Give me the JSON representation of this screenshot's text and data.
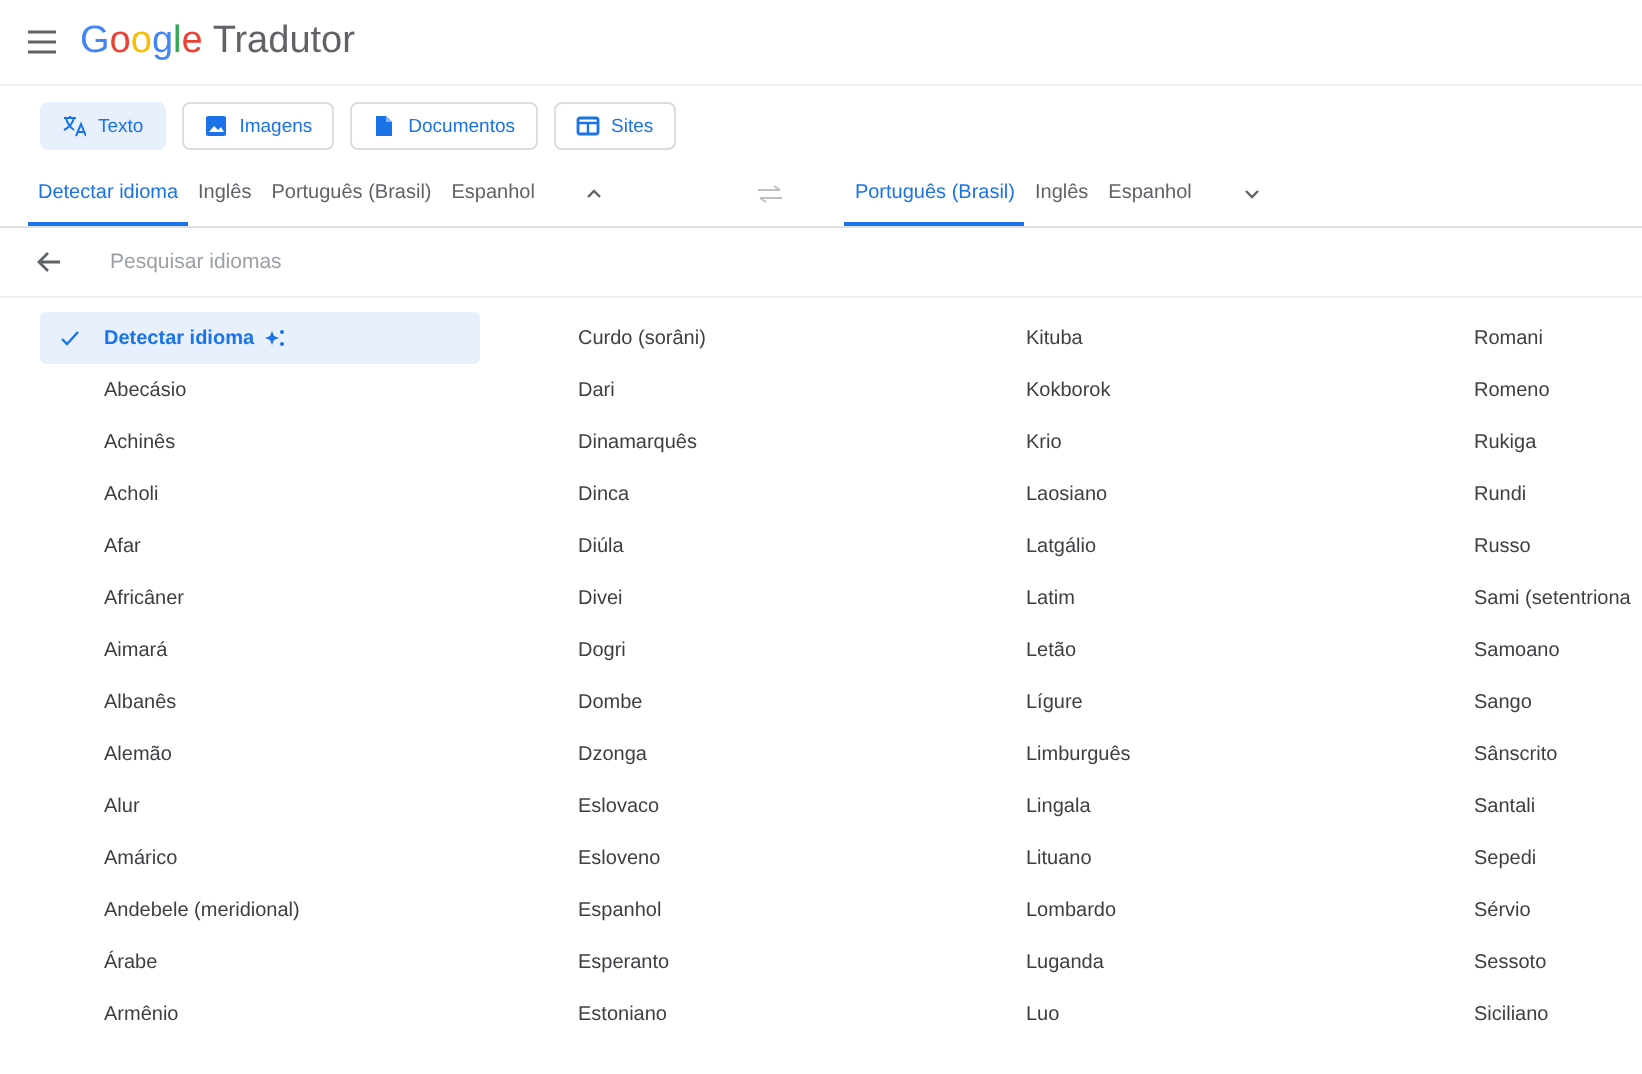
{
  "header": {
    "logo": "Google",
    "product": "Tradutor"
  },
  "modes": [
    {
      "label": "Texto",
      "kind": "translate",
      "selected": true
    },
    {
      "label": "Imagens",
      "kind": "image",
      "selected": false
    },
    {
      "label": "Documentos",
      "kind": "document",
      "selected": false
    },
    {
      "label": "Sites",
      "kind": "site",
      "selected": false
    }
  ],
  "source_languages": [
    {
      "label": "Detectar idioma",
      "selected": true
    },
    {
      "label": "Inglês",
      "selected": false
    },
    {
      "label": "Português (Brasil)",
      "selected": false
    },
    {
      "label": "Espanhol",
      "selected": false
    }
  ],
  "target_languages": [
    {
      "label": "Português (Brasil)",
      "selected": true
    },
    {
      "label": "Inglês",
      "selected": false
    },
    {
      "label": "Espanhol",
      "selected": false
    }
  ],
  "search": {
    "placeholder": "Pesquisar idiomas"
  },
  "language_columns": [
    [
      {
        "label": "Detectar idioma",
        "selected": true
      },
      {
        "label": "Abecásio",
        "selected": false
      },
      {
        "label": "Achinês",
        "selected": false
      },
      {
        "label": "Acholi",
        "selected": false
      },
      {
        "label": "Afar",
        "selected": false
      },
      {
        "label": "Africâner",
        "selected": false
      },
      {
        "label": "Aimará",
        "selected": false
      },
      {
        "label": "Albanês",
        "selected": false
      },
      {
        "label": "Alemão",
        "selected": false
      },
      {
        "label": "Alur",
        "selected": false
      },
      {
        "label": "Amárico",
        "selected": false
      },
      {
        "label": "Andebele (meridional)",
        "selected": false
      },
      {
        "label": "Árabe",
        "selected": false
      },
      {
        "label": "Armênio",
        "selected": false
      }
    ],
    [
      {
        "label": "Curdo (sorâni)",
        "selected": false
      },
      {
        "label": "Dari",
        "selected": false
      },
      {
        "label": "Dinamarquês",
        "selected": false
      },
      {
        "label": "Dinca",
        "selected": false
      },
      {
        "label": "Diúla",
        "selected": false
      },
      {
        "label": "Divei",
        "selected": false
      },
      {
        "label": "Dogri",
        "selected": false
      },
      {
        "label": "Dombe",
        "selected": false
      },
      {
        "label": "Dzonga",
        "selected": false
      },
      {
        "label": "Eslovaco",
        "selected": false
      },
      {
        "label": "Esloveno",
        "selected": false
      },
      {
        "label": "Espanhol",
        "selected": false
      },
      {
        "label": "Esperanto",
        "selected": false
      },
      {
        "label": "Estoniano",
        "selected": false
      }
    ],
    [
      {
        "label": "Kituba",
        "selected": false
      },
      {
        "label": "Kokborok",
        "selected": false
      },
      {
        "label": "Krio",
        "selected": false
      },
      {
        "label": "Laosiano",
        "selected": false
      },
      {
        "label": "Latgálio",
        "selected": false
      },
      {
        "label": "Latim",
        "selected": false
      },
      {
        "label": "Letão",
        "selected": false
      },
      {
        "label": "Lígure",
        "selected": false
      },
      {
        "label": "Limburguês",
        "selected": false
      },
      {
        "label": "Lingala",
        "selected": false
      },
      {
        "label": "Lituano",
        "selected": false
      },
      {
        "label": "Lombardo",
        "selected": false
      },
      {
        "label": "Luganda",
        "selected": false
      },
      {
        "label": "Luo",
        "selected": false
      }
    ],
    [
      {
        "label": "Romani",
        "selected": false
      },
      {
        "label": "Romeno",
        "selected": false
      },
      {
        "label": "Rukiga",
        "selected": false
      },
      {
        "label": "Rundi",
        "selected": false
      },
      {
        "label": "Russo",
        "selected": false
      },
      {
        "label": "Sami (setentriona",
        "selected": false
      },
      {
        "label": "Samoano",
        "selected": false
      },
      {
        "label": "Sango",
        "selected": false
      },
      {
        "label": "Sânscrito",
        "selected": false
      },
      {
        "label": "Santali",
        "selected": false
      },
      {
        "label": "Sepedi",
        "selected": false
      },
      {
        "label": "Sérvio",
        "selected": false
      },
      {
        "label": "Sessoto",
        "selected": false
      },
      {
        "label": "Siciliano",
        "selected": false
      }
    ]
  ]
}
